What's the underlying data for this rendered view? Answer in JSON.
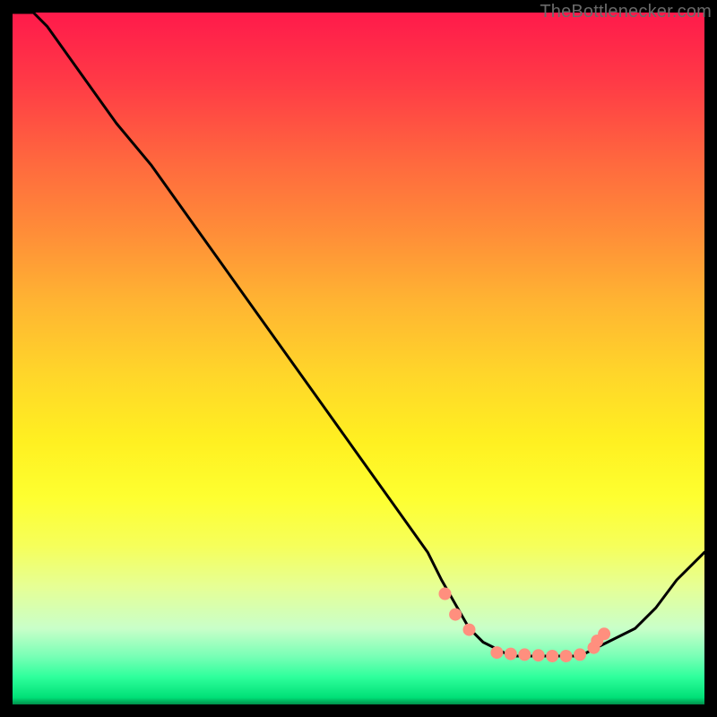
{
  "watermark": "TheBottlenecker.com",
  "colors": {
    "gradient_top": "#ff1a4b",
    "gradient_mid": "#ffd52a",
    "gradient_bottom": "#00e077",
    "curve": "#000000",
    "marker": "#ff8f7e",
    "marker_outline": "#2a2a2a",
    "frame_bg": "#000000"
  },
  "chart_data": {
    "type": "line",
    "title": "",
    "xlabel": "",
    "ylabel": "",
    "xlim": [
      0,
      100
    ],
    "ylim": [
      0,
      100
    ],
    "grid": false,
    "legend": false,
    "series": [
      {
        "name": "bottleneck-curve",
        "x": [
          0,
          3,
          5,
          10,
          15,
          20,
          25,
          30,
          35,
          40,
          45,
          50,
          55,
          60,
          62,
          66,
          68,
          70,
          72,
          74,
          76,
          78,
          80,
          82,
          84,
          86,
          90,
          93,
          96,
          100
        ],
        "y": [
          100,
          100,
          98,
          91,
          84,
          78,
          71,
          64,
          57,
          50,
          43,
          36,
          29,
          22,
          18,
          11,
          9,
          8,
          7,
          7,
          7,
          7,
          7,
          7,
          8,
          9,
          11,
          14,
          18,
          22
        ]
      }
    ],
    "markers": {
      "name": "highlight-points",
      "x": [
        62.5,
        64,
        66,
        70,
        72,
        74,
        76,
        78,
        80,
        82,
        84,
        84.5,
        85.5
      ],
      "y": [
        16,
        13,
        10.8,
        7.5,
        7.3,
        7.2,
        7.1,
        7,
        7,
        7.2,
        8.2,
        9.2,
        10.2
      ]
    }
  }
}
